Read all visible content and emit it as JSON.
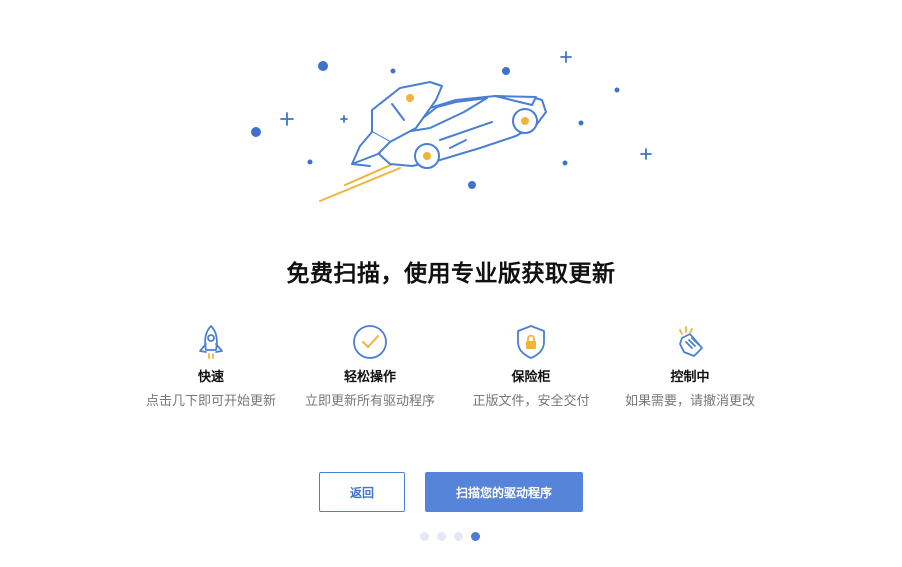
{
  "colors": {
    "accent": "#4b7bd3",
    "accent_button": "#5584d8",
    "highlight": "#f0b43c",
    "dot_inactive": "#e3e8f2",
    "description_text": "#777777"
  },
  "hero": {
    "icon": "rocket-car-illustration"
  },
  "heading": "免费扫描，使用专业版获取更新",
  "features": [
    {
      "icon": "rocket-icon",
      "title": "快速",
      "description": "点击几下即可开始更新"
    },
    {
      "icon": "checkmark-circle-icon",
      "title": "轻松操作",
      "description": "立即更新所有驱动程序"
    },
    {
      "icon": "shield-lock-icon",
      "title": "保险柜",
      "description": "正版文件，安全交付"
    },
    {
      "icon": "hand-pointer-icon",
      "title": "控制中",
      "description": "如果需要，请撤消更改"
    }
  ],
  "buttons": {
    "back": "返回",
    "scan": "扫描您的驱动程序"
  },
  "pagination": {
    "total": 4,
    "active": 4
  }
}
